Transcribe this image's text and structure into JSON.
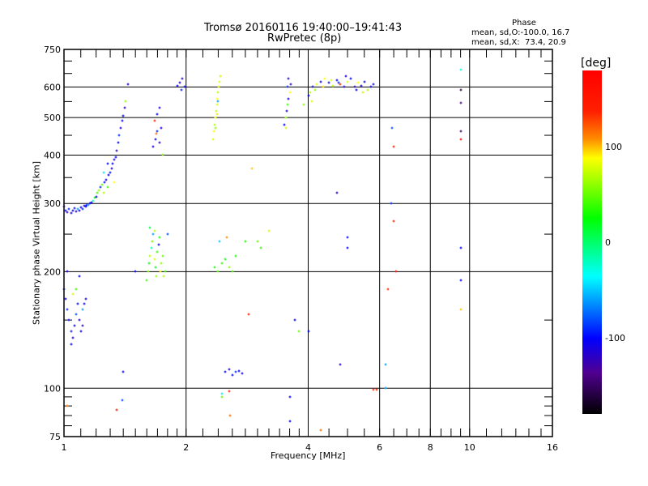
{
  "chart_data": {
    "type": "scatter",
    "title": "Tromsø 20160116 19:40:00–19:41:43",
    "subtitle": "RwPretec (8p)",
    "xlabel": "Frequency [MHz]",
    "ylabel": "Stationary phase Virtual Height [km]",
    "xscale": "log",
    "yscale": "log",
    "xlim": [
      1,
      16
    ],
    "ylim": [
      75,
      750
    ],
    "xticks": [
      1,
      2,
      4,
      6,
      8,
      10,
      16
    ],
    "xtick_labels": [
      "1",
      "2",
      "4",
      "6",
      "8",
      "10",
      "16"
    ],
    "yticks": [
      75,
      100,
      200,
      300,
      400,
      500,
      600,
      750
    ],
    "ytick_labels": [
      "75",
      "100",
      "200",
      "300",
      "400",
      "500",
      "600",
      "750"
    ],
    "grid": true,
    "stats": {
      "heading": "Phase",
      "o_line": "mean, sd,O:-100.0, 16.7",
      "x_line": "mean, sd,X:  73.4, 20.9"
    },
    "colorbar": {
      "label": "[deg]",
      "range": [
        -180,
        180
      ],
      "ticks": [
        100,
        0,
        -100
      ],
      "tick_labels": [
        "100",
        "0",
        "-100"
      ]
    },
    "point_fields": [
      "frequency_MHz",
      "height_km",
      "phase_deg"
    ],
    "points": [
      [
        1.0,
        295,
        -110
      ],
      [
        1.01,
        288,
        -100
      ],
      [
        1.02,
        285,
        -120
      ],
      [
        1.03,
        290,
        -90
      ],
      [
        1.04,
        283,
        -110
      ],
      [
        1.05,
        287,
        -100
      ],
      [
        1.06,
        292,
        -95
      ],
      [
        1.07,
        286,
        -115
      ],
      [
        1.08,
        290,
        -60
      ],
      [
        1.09,
        288,
        -105
      ],
      [
        1.1,
        293,
        -100
      ],
      [
        1.11,
        291,
        -90
      ],
      [
        1.12,
        296,
        -110
      ],
      [
        1.13,
        295,
        -100
      ],
      [
        1.14,
        298,
        -95
      ],
      [
        1.15,
        298,
        -70
      ],
      [
        1.16,
        300,
        -100
      ],
      [
        1.17,
        302,
        -110
      ],
      [
        1.18,
        305,
        -20
      ],
      [
        1.19,
        310,
        30
      ],
      [
        1.2,
        312,
        -100
      ],
      [
        1.21,
        320,
        40
      ],
      [
        1.22,
        325,
        60
      ],
      [
        1.23,
        330,
        -90
      ],
      [
        1.24,
        335,
        50
      ],
      [
        1.25,
        320,
        70
      ],
      [
        1.26,
        340,
        -100
      ],
      [
        1.27,
        345,
        -110
      ],
      [
        1.28,
        330,
        40
      ],
      [
        1.29,
        355,
        -100
      ],
      [
        1.3,
        360,
        -95
      ],
      [
        1.31,
        370,
        -110
      ],
      [
        1.32,
        380,
        -100
      ],
      [
        1.33,
        390,
        -120
      ],
      [
        1.34,
        395,
        -100
      ],
      [
        1.35,
        410,
        -110
      ],
      [
        1.36,
        430,
        -100
      ],
      [
        1.37,
        450,
        -90
      ],
      [
        1.38,
        470,
        -110
      ],
      [
        1.39,
        490,
        -100
      ],
      [
        1.4,
        505,
        -105
      ],
      [
        1.41,
        530,
        -110
      ],
      [
        1.42,
        550,
        60
      ],
      [
        1.44,
        610,
        -110
      ],
      [
        1.25,
        360,
        -40
      ],
      [
        1.28,
        380,
        -100
      ],
      [
        1.33,
        340,
        90
      ],
      [
        1.0,
        180,
        -100
      ],
      [
        1.01,
        170,
        -110
      ],
      [
        1.02,
        160,
        -90
      ],
      [
        1.03,
        150,
        -100
      ],
      [
        1.04,
        140,
        -95
      ],
      [
        1.05,
        135,
        -110
      ],
      [
        1.06,
        145,
        -100
      ],
      [
        1.07,
        155,
        -80
      ],
      [
        1.08,
        165,
        -100
      ],
      [
        1.09,
        150,
        -110
      ],
      [
        1.1,
        140,
        -100
      ],
      [
        1.11,
        160,
        -60
      ],
      [
        1.12,
        165,
        -100
      ],
      [
        1.13,
        170,
        -110
      ],
      [
        1.05,
        175,
        80
      ],
      [
        1.07,
        180,
        40
      ],
      [
        1.09,
        195,
        -100
      ],
      [
        1.02,
        200,
        -110
      ],
      [
        1.11,
        145,
        -120
      ],
      [
        1.04,
        130,
        -100
      ],
      [
        1.6,
        190,
        40
      ],
      [
        1.61,
        200,
        60
      ],
      [
        1.62,
        210,
        30
      ],
      [
        1.63,
        220,
        70
      ],
      [
        1.64,
        230,
        -20
      ],
      [
        1.65,
        240,
        50
      ],
      [
        1.66,
        250,
        -60
      ],
      [
        1.67,
        215,
        80
      ],
      [
        1.68,
        205,
        20
      ],
      [
        1.69,
        195,
        60
      ],
      [
        1.7,
        225,
        40
      ],
      [
        1.71,
        235,
        -100
      ],
      [
        1.72,
        245,
        30
      ],
      [
        1.73,
        200,
        90
      ],
      [
        1.74,
        210,
        60
      ],
      [
        1.75,
        220,
        50
      ],
      [
        1.76,
        195,
        70
      ],
      [
        1.78,
        200,
        40
      ],
      [
        1.8,
        250,
        -80
      ],
      [
        1.63,
        260,
        10
      ],
      [
        1.67,
        255,
        70
      ],
      [
        1.66,
        420,
        -110
      ],
      [
        1.68,
        440,
        -100
      ],
      [
        1.7,
        460,
        -90
      ],
      [
        1.72,
        430,
        -120
      ],
      [
        1.74,
        470,
        -110
      ],
      [
        1.67,
        490,
        150
      ],
      [
        1.7,
        510,
        -100
      ],
      [
        1.72,
        530,
        -110
      ],
      [
        1.75,
        400,
        60
      ],
      [
        1.69,
        455,
        120
      ],
      [
        1.9,
        605,
        -100
      ],
      [
        1.93,
        615,
        -110
      ],
      [
        1.96,
        630,
        -120
      ],
      [
        1.98,
        600,
        -100
      ],
      [
        1.95,
        590,
        -90
      ],
      [
        2.33,
        440,
        80
      ],
      [
        2.34,
        460,
        90
      ],
      [
        2.35,
        480,
        70
      ],
      [
        2.36,
        500,
        85
      ],
      [
        2.37,
        520,
        75
      ],
      [
        2.38,
        540,
        80
      ],
      [
        2.39,
        560,
        90
      ],
      [
        2.4,
        580,
        70
      ],
      [
        2.41,
        600,
        85
      ],
      [
        2.42,
        620,
        80
      ],
      [
        2.43,
        640,
        75
      ],
      [
        2.36,
        470,
        60
      ],
      [
        2.38,
        510,
        95
      ],
      [
        2.4,
        550,
        -60
      ],
      [
        2.35,
        205,
        30
      ],
      [
        2.4,
        200,
        50
      ],
      [
        2.45,
        210,
        40
      ],
      [
        2.5,
        215,
        20
      ],
      [
        2.55,
        205,
        60
      ],
      [
        2.6,
        200,
        45
      ],
      [
        2.65,
        220,
        30
      ],
      [
        2.42,
        240,
        -50
      ],
      [
        2.52,
        245,
        110
      ],
      [
        2.8,
        240,
        30
      ],
      [
        3.0,
        240,
        50
      ],
      [
        3.05,
        230,
        40
      ],
      [
        2.5,
        110,
        -100
      ],
      [
        2.55,
        112,
        -110
      ],
      [
        2.6,
        108,
        -100
      ],
      [
        2.65,
        110,
        -90
      ],
      [
        2.7,
        111,
        -100
      ],
      [
        2.75,
        109,
        -110
      ],
      [
        3.5,
        480,
        -100
      ],
      [
        3.52,
        500,
        60
      ],
      [
        3.54,
        520,
        -110
      ],
      [
        3.56,
        540,
        40
      ],
      [
        3.58,
        560,
        -100
      ],
      [
        3.6,
        580,
        90
      ],
      [
        3.55,
        600,
        -90
      ],
      [
        3.57,
        630,
        -110
      ],
      [
        3.62,
        610,
        -120
      ],
      [
        3.53,
        470,
        80
      ],
      [
        4.0,
        570,
        -100
      ],
      [
        4.05,
        580,
        70
      ],
      [
        4.1,
        600,
        -110
      ],
      [
        4.2,
        610,
        80
      ],
      [
        4.3,
        620,
        -100
      ],
      [
        4.4,
        630,
        90
      ],
      [
        4.5,
        615,
        -110
      ],
      [
        4.6,
        605,
        70
      ],
      [
        4.7,
        625,
        -100
      ],
      [
        4.8,
        610,
        140
      ],
      [
        4.9,
        600,
        -110
      ],
      [
        5.0,
        620,
        80
      ],
      [
        5.1,
        630,
        -100
      ],
      [
        5.2,
        600,
        -120
      ],
      [
        5.3,
        615,
        90
      ],
      [
        5.4,
        605,
        -110
      ],
      [
        5.5,
        620,
        -100
      ],
      [
        5.6,
        590,
        70
      ],
      [
        5.7,
        600,
        -100
      ],
      [
        5.8,
        610,
        -110
      ],
      [
        4.15,
        590,
        60
      ],
      [
        4.35,
        600,
        95
      ],
      [
        4.55,
        625,
        80
      ],
      [
        4.75,
        615,
        -90
      ],
      [
        4.95,
        640,
        -110
      ],
      [
        5.25,
        590,
        -100
      ],
      [
        5.45,
        580,
        75
      ],
      [
        4.08,
        550,
        80
      ],
      [
        3.9,
        540,
        60
      ],
      [
        1.4,
        110,
        -100
      ],
      [
        1.39,
        93,
        -80
      ],
      [
        1.35,
        88,
        160
      ],
      [
        1.02,
        90,
        120
      ],
      [
        1.5,
        200,
        -100
      ],
      [
        2.45,
        97,
        -40
      ],
      [
        2.55,
        98,
        150
      ],
      [
        2.45,
        95,
        50
      ],
      [
        2.57,
        85,
        120
      ],
      [
        3.6,
        95,
        -100
      ],
      [
        3.6,
        82,
        -100
      ],
      [
        4.3,
        78,
        120
      ],
      [
        5.8,
        99,
        140
      ],
      [
        5.9,
        99,
        160
      ],
      [
        6.2,
        100,
        -60
      ],
      [
        6.3,
        180,
        140
      ],
      [
        6.5,
        270,
        150
      ],
      [
        6.6,
        200,
        160
      ],
      [
        6.4,
        300,
        -90
      ],
      [
        6.45,
        470,
        -80
      ],
      [
        6.5,
        420,
        150
      ],
      [
        4.8,
        115,
        -110
      ],
      [
        5.0,
        230,
        -100
      ],
      [
        5.0,
        245,
        -100
      ],
      [
        4.7,
        320,
        -110
      ],
      [
        3.7,
        150,
        -100
      ],
      [
        3.8,
        140,
        50
      ],
      [
        4.0,
        140,
        -100
      ],
      [
        9.5,
        230,
        -100
      ],
      [
        9.5,
        190,
        -100
      ],
      [
        9.5,
        160,
        100
      ],
      [
        9.5,
        440,
        170
      ],
      [
        9.5,
        460,
        -150
      ],
      [
        9.5,
        545,
        -140
      ],
      [
        9.5,
        590,
        -160
      ],
      [
        9.5,
        665,
        -30
      ],
      [
        6.2,
        115,
        -60
      ],
      [
        2.9,
        370,
        100
      ],
      [
        2.85,
        155,
        150
      ],
      [
        3.2,
        255,
        80
      ]
    ]
  }
}
